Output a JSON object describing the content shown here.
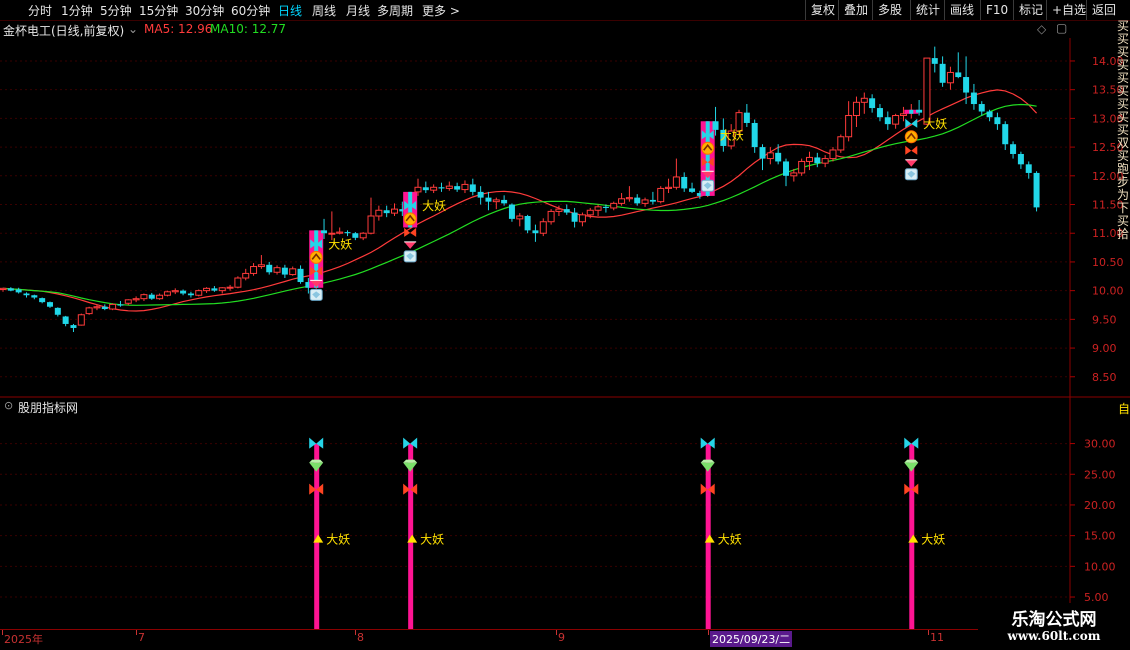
{
  "toolbar": {
    "periods": [
      "分时",
      "1分钟",
      "5分钟",
      "15分钟",
      "30分钟",
      "60分钟",
      "日线",
      "周线",
      "月线",
      "多周期",
      "更多 >"
    ],
    "active_period": "日线",
    "right_buttons": [
      "复权",
      "叠加",
      "多股",
      "统计",
      "画线",
      "F10",
      "标记",
      "+自选",
      "返回"
    ]
  },
  "header": {
    "stock_name": "金杯电工(日线,前复权)",
    "ma5_label": "MA5: 12.96",
    "ma10_label": "MA10: 12.77",
    "ma5_color": "#ff3b3b",
    "ma10_color": "#22dd22"
  },
  "sub_panel": {
    "title": "股朋指标网",
    "right_label": "自"
  },
  "price_axis": [
    "14.00",
    "13.50",
    "13.00",
    "12.50",
    "12.00",
    "11.50",
    "11.00",
    "10.50",
    "10.00",
    "9.50",
    "9.00",
    "8.50"
  ],
  "sub_axis": [
    "30.00",
    "25.00",
    "20.00",
    "15.00",
    "10.00",
    "5.00"
  ],
  "signal_label": "大妖",
  "date_axis": [
    {
      "label": "2025年",
      "highlight": false
    },
    {
      "label": "7",
      "highlight": false
    },
    {
      "label": "8",
      "highlight": false
    },
    {
      "label": "9",
      "highlight": false
    },
    {
      "label": "2025/09/23/二",
      "highlight": true
    },
    {
      "label": "11",
      "highlight": false
    }
  ],
  "watermark": {
    "title": "乐淘公式网",
    "url": "www.60lt.com"
  },
  "side_strip": "买买买买买买买买买双买跑步为下买拾",
  "colors": {
    "up_candle": "#ff3b3b",
    "down_candle": "#21d7e8",
    "signal_bar": "#ff1493",
    "grid": "#3a0000",
    "axis_text": "#cc2222"
  },
  "chart_data": {
    "type": "candlestick",
    "ylim": [
      8.2,
      14.4
    ],
    "sub_ylim": [
      0,
      35
    ],
    "candles": [
      [
        10.02,
        10.05,
        9.98,
        10.04
      ],
      [
        10.04,
        10.06,
        9.99,
        10.0
      ],
      [
        10.02,
        10.05,
        9.95,
        9.97
      ],
      [
        9.95,
        9.97,
        9.88,
        9.92
      ],
      [
        9.92,
        9.93,
        9.85,
        9.88
      ],
      [
        9.87,
        9.88,
        9.78,
        9.8
      ],
      [
        9.8,
        9.81,
        9.7,
        9.72
      ],
      [
        9.7,
        9.71,
        9.55,
        9.58
      ],
      [
        9.55,
        9.56,
        9.38,
        9.42
      ],
      [
        9.4,
        9.42,
        9.28,
        9.35
      ],
      [
        9.4,
        9.6,
        9.39,
        9.58
      ],
      [
        9.6,
        9.72,
        9.58,
        9.7
      ],
      [
        9.7,
        9.75,
        9.66,
        9.72
      ],
      [
        9.72,
        9.76,
        9.66,
        9.68
      ],
      [
        9.68,
        9.78,
        9.66,
        9.76
      ],
      [
        9.76,
        9.82,
        9.72,
        9.74
      ],
      [
        9.78,
        9.85,
        9.75,
        9.84
      ],
      [
        9.84,
        9.9,
        9.8,
        9.86
      ],
      [
        9.86,
        9.95,
        9.82,
        9.93
      ],
      [
        9.93,
        9.96,
        9.84,
        9.86
      ],
      [
        9.86,
        9.95,
        9.84,
        9.92
      ],
      [
        9.92,
        10.0,
        9.9,
        9.98
      ],
      [
        9.98,
        10.04,
        9.94,
        10.0
      ],
      [
        10.0,
        10.02,
        9.92,
        9.95
      ],
      [
        9.95,
        9.98,
        9.88,
        9.92
      ],
      [
        9.92,
        10.02,
        9.9,
        10.0
      ],
      [
        10.0,
        10.06,
        9.96,
        10.04
      ],
      [
        10.04,
        10.08,
        9.98,
        10.0
      ],
      [
        10.0,
        10.06,
        9.95,
        10.05
      ],
      [
        10.05,
        10.1,
        10.0,
        10.06
      ],
      [
        10.06,
        10.25,
        10.04,
        10.22
      ],
      [
        10.22,
        10.38,
        10.18,
        10.3
      ],
      [
        10.3,
        10.48,
        10.26,
        10.42
      ],
      [
        10.42,
        10.62,
        10.38,
        10.45
      ],
      [
        10.45,
        10.5,
        10.28,
        10.32
      ],
      [
        10.32,
        10.44,
        10.28,
        10.4
      ],
      [
        10.4,
        10.45,
        10.22,
        10.28
      ],
      [
        10.28,
        10.42,
        10.26,
        10.38
      ],
      [
        10.38,
        10.44,
        10.12,
        10.15
      ],
      [
        10.15,
        10.22,
        9.95,
        10.05
      ],
      [
        10.05,
        11.05,
        10.03,
        11.05
      ],
      [
        11.05,
        11.25,
        10.9,
        11.0
      ],
      [
        11.0,
        11.38,
        10.88,
        11.0
      ],
      [
        11.0,
        11.1,
        10.98,
        11.02
      ],
      [
        11.02,
        11.05,
        10.95,
        11.0
      ],
      [
        11.0,
        11.02,
        10.88,
        10.92
      ],
      [
        10.92,
        11.02,
        10.88,
        11.0
      ],
      [
        11.0,
        11.62,
        10.98,
        11.3
      ],
      [
        11.3,
        11.48,
        11.22,
        11.4
      ],
      [
        11.4,
        11.48,
        11.28,
        11.35
      ],
      [
        11.35,
        11.52,
        11.3,
        11.42
      ],
      [
        11.42,
        11.55,
        11.3,
        11.38
      ],
      [
        11.1,
        11.72,
        11.08,
        11.72
      ],
      [
        11.72,
        11.95,
        11.65,
        11.8
      ],
      [
        11.8,
        11.9,
        11.7,
        11.75
      ],
      [
        11.75,
        11.85,
        11.7,
        11.8
      ],
      [
        11.8,
        11.88,
        11.72,
        11.78
      ],
      [
        11.78,
        11.9,
        11.74,
        11.82
      ],
      [
        11.82,
        11.88,
        11.72,
        11.76
      ],
      [
        11.76,
        11.92,
        11.7,
        11.85
      ],
      [
        11.85,
        11.95,
        11.66,
        11.72
      ],
      [
        11.72,
        11.82,
        11.5,
        11.62
      ],
      [
        11.62,
        11.72,
        11.4,
        11.55
      ],
      [
        11.55,
        11.62,
        11.42,
        11.58
      ],
      [
        11.58,
        11.66,
        11.48,
        11.52
      ],
      [
        11.5,
        11.52,
        11.2,
        11.25
      ],
      [
        11.25,
        11.35,
        11.12,
        11.3
      ],
      [
        11.3,
        11.32,
        11.0,
        11.05
      ],
      [
        11.05,
        11.15,
        10.85,
        11.0
      ],
      [
        11.0,
        11.26,
        10.95,
        11.2
      ],
      [
        11.2,
        11.42,
        11.15,
        11.38
      ],
      [
        11.38,
        11.48,
        11.3,
        11.42
      ],
      [
        11.42,
        11.5,
        11.32,
        11.36
      ],
      [
        11.36,
        11.44,
        11.1,
        11.2
      ],
      [
        11.2,
        11.36,
        11.12,
        11.32
      ],
      [
        11.32,
        11.44,
        11.26,
        11.4
      ],
      [
        11.4,
        11.5,
        11.3,
        11.46
      ],
      [
        11.46,
        11.5,
        11.36,
        11.44
      ],
      [
        11.44,
        11.55,
        11.4,
        11.52
      ],
      [
        11.52,
        11.7,
        11.48,
        11.6
      ],
      [
        11.6,
        11.82,
        11.55,
        11.62
      ],
      [
        11.62,
        11.68,
        11.48,
        11.52
      ],
      [
        11.52,
        11.62,
        11.46,
        11.58
      ],
      [
        11.58,
        11.72,
        11.5,
        11.55
      ],
      [
        11.55,
        11.82,
        11.52,
        11.78
      ],
      [
        11.78,
        11.95,
        11.7,
        11.8
      ],
      [
        11.8,
        12.3,
        11.76,
        11.98
      ],
      [
        11.98,
        12.06,
        11.72,
        11.78
      ],
      [
        11.78,
        11.88,
        11.7,
        11.72
      ],
      [
        11.7,
        11.74,
        11.6,
        11.65
      ],
      [
        11.65,
        12.95,
        11.63,
        12.95
      ],
      [
        12.95,
        13.2,
        12.7,
        12.8
      ],
      [
        12.8,
        13.0,
        12.42,
        12.52
      ],
      [
        12.52,
        12.9,
        12.46,
        12.78
      ],
      [
        12.78,
        13.15,
        12.7,
        13.1
      ],
      [
        13.1,
        13.25,
        12.85,
        12.92
      ],
      [
        12.92,
        12.98,
        12.4,
        12.5
      ],
      [
        12.5,
        12.55,
        12.1,
        12.3
      ],
      [
        12.3,
        12.5,
        12.2,
        12.4
      ],
      [
        12.4,
        12.55,
        12.2,
        12.25
      ],
      [
        12.25,
        12.3,
        11.82,
        12.0
      ],
      [
        12.0,
        12.12,
        11.9,
        12.05
      ],
      [
        12.05,
        12.3,
        12.0,
        12.25
      ],
      [
        12.25,
        12.42,
        12.1,
        12.32
      ],
      [
        12.32,
        12.4,
        12.15,
        12.22
      ],
      [
        12.22,
        12.36,
        12.15,
        12.3
      ],
      [
        12.3,
        12.5,
        12.25,
        12.45
      ],
      [
        12.45,
        12.72,
        12.4,
        12.68
      ],
      [
        12.68,
        13.3,
        12.6,
        13.05
      ],
      [
        13.05,
        13.38,
        12.85,
        13.28
      ],
      [
        13.28,
        13.45,
        13.08,
        13.35
      ],
      [
        13.35,
        13.42,
        13.1,
        13.18
      ],
      [
        13.18,
        13.25,
        12.95,
        13.02
      ],
      [
        13.02,
        13.12,
        12.8,
        12.9
      ],
      [
        12.9,
        13.08,
        12.82,
        13.05
      ],
      [
        13.05,
        13.2,
        12.95,
        13.08
      ],
      [
        13.08,
        13.25,
        13.0,
        13.15
      ],
      [
        13.15,
        13.32,
        13.05,
        13.1
      ],
      [
        12.9,
        14.05,
        12.88,
        14.05
      ],
      [
        14.05,
        14.25,
        13.8,
        13.95
      ],
      [
        13.95,
        14.08,
        13.55,
        13.62
      ],
      [
        13.62,
        13.9,
        13.5,
        13.8
      ],
      [
        13.8,
        14.15,
        13.7,
        13.72
      ],
      [
        13.72,
        14.08,
        13.25,
        13.45
      ],
      [
        13.45,
        13.6,
        13.15,
        13.25
      ],
      [
        13.25,
        13.3,
        13.05,
        13.12
      ],
      [
        13.12,
        13.15,
        12.95,
        13.02
      ],
      [
        13.02,
        13.1,
        12.8,
        12.9
      ],
      [
        12.9,
        12.95,
        12.45,
        12.55
      ],
      [
        12.55,
        12.6,
        12.3,
        12.38
      ],
      [
        12.38,
        12.42,
        12.12,
        12.2
      ],
      [
        12.2,
        12.25,
        11.95,
        12.05
      ],
      [
        12.05,
        12.08,
        11.38,
        11.45
      ]
    ],
    "signal_indices": [
      40,
      52,
      90,
      116
    ],
    "signal_values": [
      30,
      30,
      30,
      30
    ]
  }
}
